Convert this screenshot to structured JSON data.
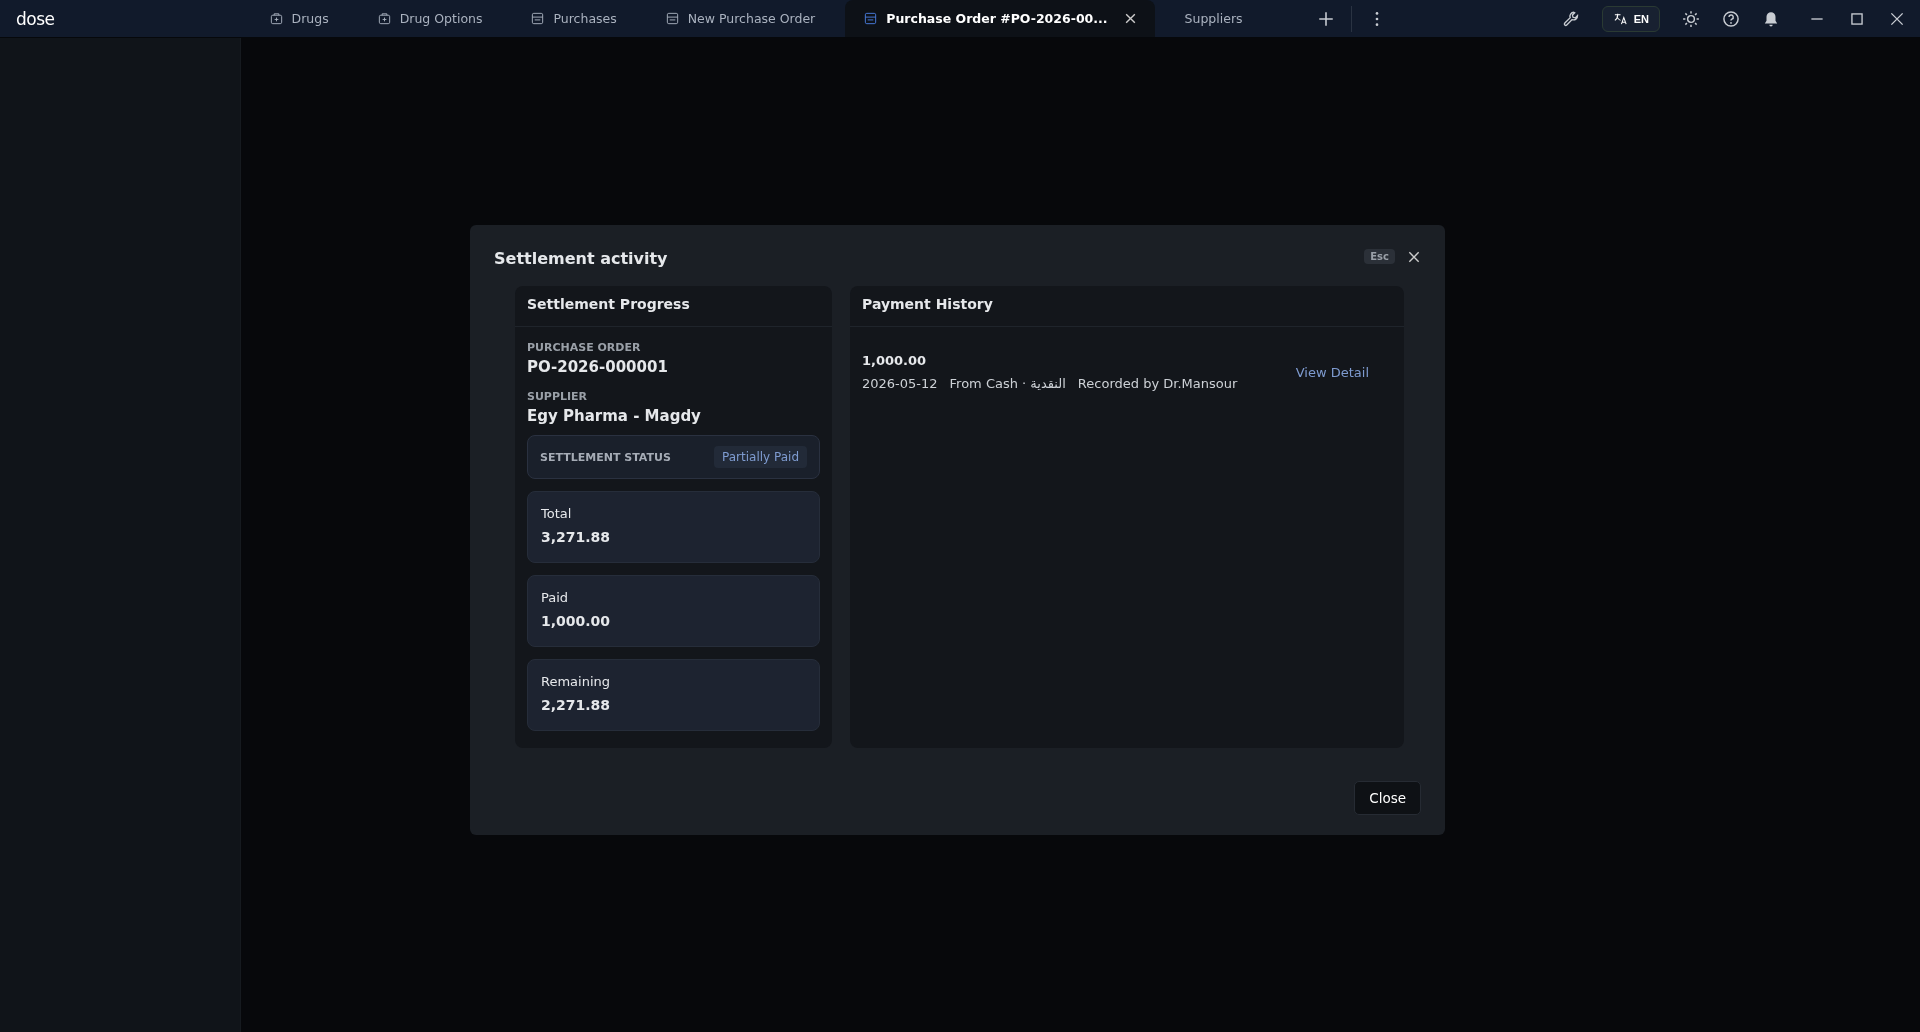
{
  "app": {
    "logo": "dose"
  },
  "tabs": [
    {
      "label": "Drugs",
      "kind": "drug",
      "selected": false,
      "closable": false
    },
    {
      "label": "Drug Options",
      "kind": "drug",
      "selected": false,
      "closable": false
    },
    {
      "label": "Purchases",
      "kind": "purchase",
      "selected": false,
      "closable": false
    },
    {
      "label": "New Purchase Order",
      "kind": "purchase",
      "selected": false,
      "closable": false
    },
    {
      "label": "Purchase Order #PO-2026-00...",
      "kind": "purchase",
      "selected": true,
      "closable": true
    },
    {
      "label": "Suppliers",
      "kind": "plain",
      "selected": false,
      "closable": false
    }
  ],
  "language": {
    "label": "EN"
  },
  "dialog": {
    "title": "Settlement activity",
    "esc_hint": "Esc",
    "progress": {
      "title": "Settlement Progress",
      "po_label": "PURCHASE ORDER",
      "po_number": "PO-2026-000001",
      "supplier_label": "SUPPLIER",
      "supplier": "Egy Pharma - Magdy",
      "status_label": "SETTLEMENT STATUS",
      "status": "Partially Paid",
      "amounts": [
        {
          "label": "Total",
          "value": "3,271.88"
        },
        {
          "label": "Paid",
          "value": "1,000.00"
        },
        {
          "label": "Remaining",
          "value": "2,271.88"
        }
      ]
    },
    "history": {
      "title": "Payment History",
      "payments": [
        {
          "amount": "1,000.00",
          "date": "2026-05-12",
          "method": "From Cash · النقدية",
          "recorded_by": "Recorded by Dr.Mansour",
          "link": "View Detail"
        }
      ]
    },
    "close_button": "Close"
  }
}
